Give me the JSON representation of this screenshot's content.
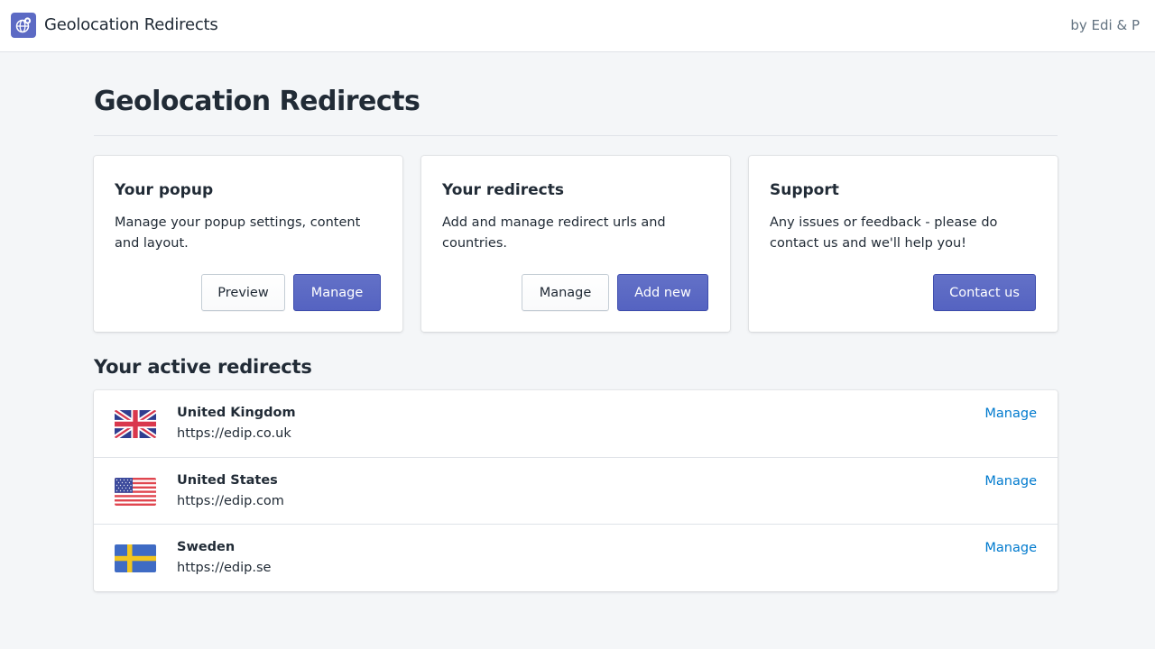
{
  "topbar": {
    "app_title": "Geolocation Redirects",
    "byline": "by Edi & P",
    "icon": "globe-pin-icon",
    "icon_color": "#5c6ac4"
  },
  "page": {
    "title": "Geolocation Redirects"
  },
  "cards": [
    {
      "title": "Your popup",
      "description": "Manage your popup settings, content and layout.",
      "buttons": [
        {
          "label": "Preview",
          "style": "secondary"
        },
        {
          "label": "Manage",
          "style": "primary"
        }
      ]
    },
    {
      "title": "Your redirects",
      "description": "Add and manage redirect urls and countries.",
      "buttons": [
        {
          "label": "Manage",
          "style": "secondary"
        },
        {
          "label": "Add new",
          "style": "primary"
        }
      ]
    },
    {
      "title": "Support",
      "description": "Any issues or feedback - please do contact us and we'll help you!",
      "buttons": [
        {
          "label": "Contact us",
          "style": "primary"
        }
      ]
    }
  ],
  "active_redirects": {
    "title": "Your active redirects",
    "items": [
      {
        "country": "United Kingdom",
        "url": "https://edip.co.uk",
        "action": "Manage",
        "flag": "uk-flag-icon"
      },
      {
        "country": "United States",
        "url": "https://edip.com",
        "action": "Manage",
        "flag": "us-flag-icon"
      },
      {
        "country": "Sweden",
        "url": "https://edip.se",
        "action": "Manage",
        "flag": "sweden-flag-icon"
      }
    ]
  },
  "colors": {
    "primary": "#5c6ac4",
    "link": "#007ace",
    "background": "#f4f6f8"
  }
}
